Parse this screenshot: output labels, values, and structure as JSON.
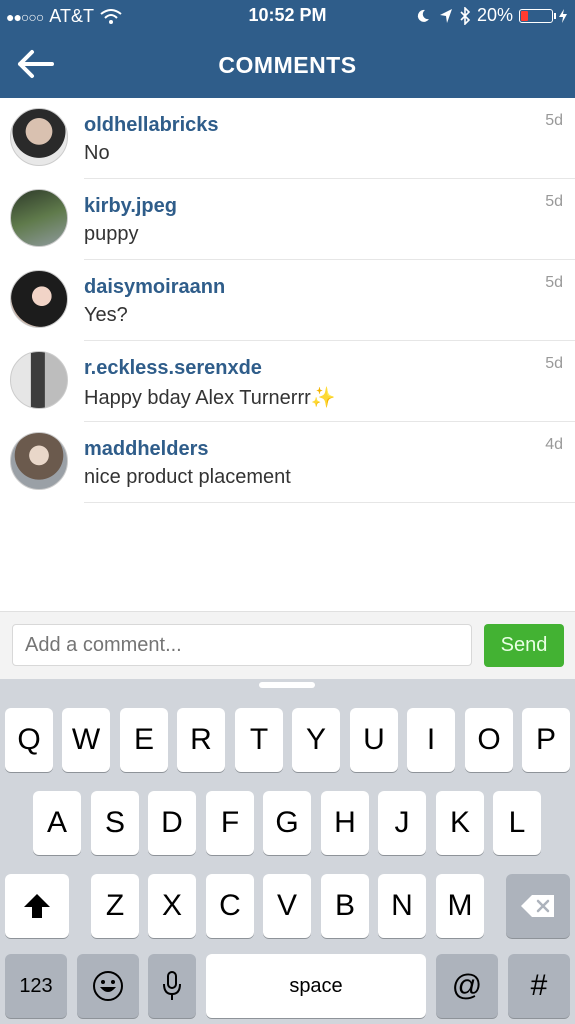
{
  "status_bar": {
    "carrier": "AT&T",
    "time": "10:52 PM",
    "battery_percent": "20%",
    "battery_level": 0.2
  },
  "nav": {
    "title": "COMMENTS",
    "back_icon": "arrow-left-icon"
  },
  "comments": [
    {
      "username": "oldhellabricks",
      "text": "No",
      "age": "5d"
    },
    {
      "username": "kirby.jpeg",
      "text": "puppy",
      "age": "5d"
    },
    {
      "username": "daisymoiraann",
      "text": "Yes?",
      "age": "5d"
    },
    {
      "username": "r.eckless.serenxde",
      "text": "Happy bday Alex Turnerrr✨",
      "age": "5d"
    },
    {
      "username": "maddhelders",
      "text": "nice product placement",
      "age": "4d"
    }
  ],
  "composer": {
    "placeholder": "Add a comment...",
    "send_label": "Send"
  },
  "keyboard": {
    "row1": [
      "Q",
      "W",
      "E",
      "R",
      "T",
      "Y",
      "U",
      "I",
      "O",
      "P"
    ],
    "row2": [
      "A",
      "S",
      "D",
      "F",
      "G",
      "H",
      "J",
      "K",
      "L"
    ],
    "row3": [
      "Z",
      "X",
      "C",
      "V",
      "B",
      "N",
      "M"
    ],
    "numbers_label": "123",
    "space_label": "space",
    "at_label": "@",
    "hash_label": "#"
  },
  "colors": {
    "header": "#2f5d8a",
    "username": "#2f5d8a",
    "send": "#43b233"
  }
}
